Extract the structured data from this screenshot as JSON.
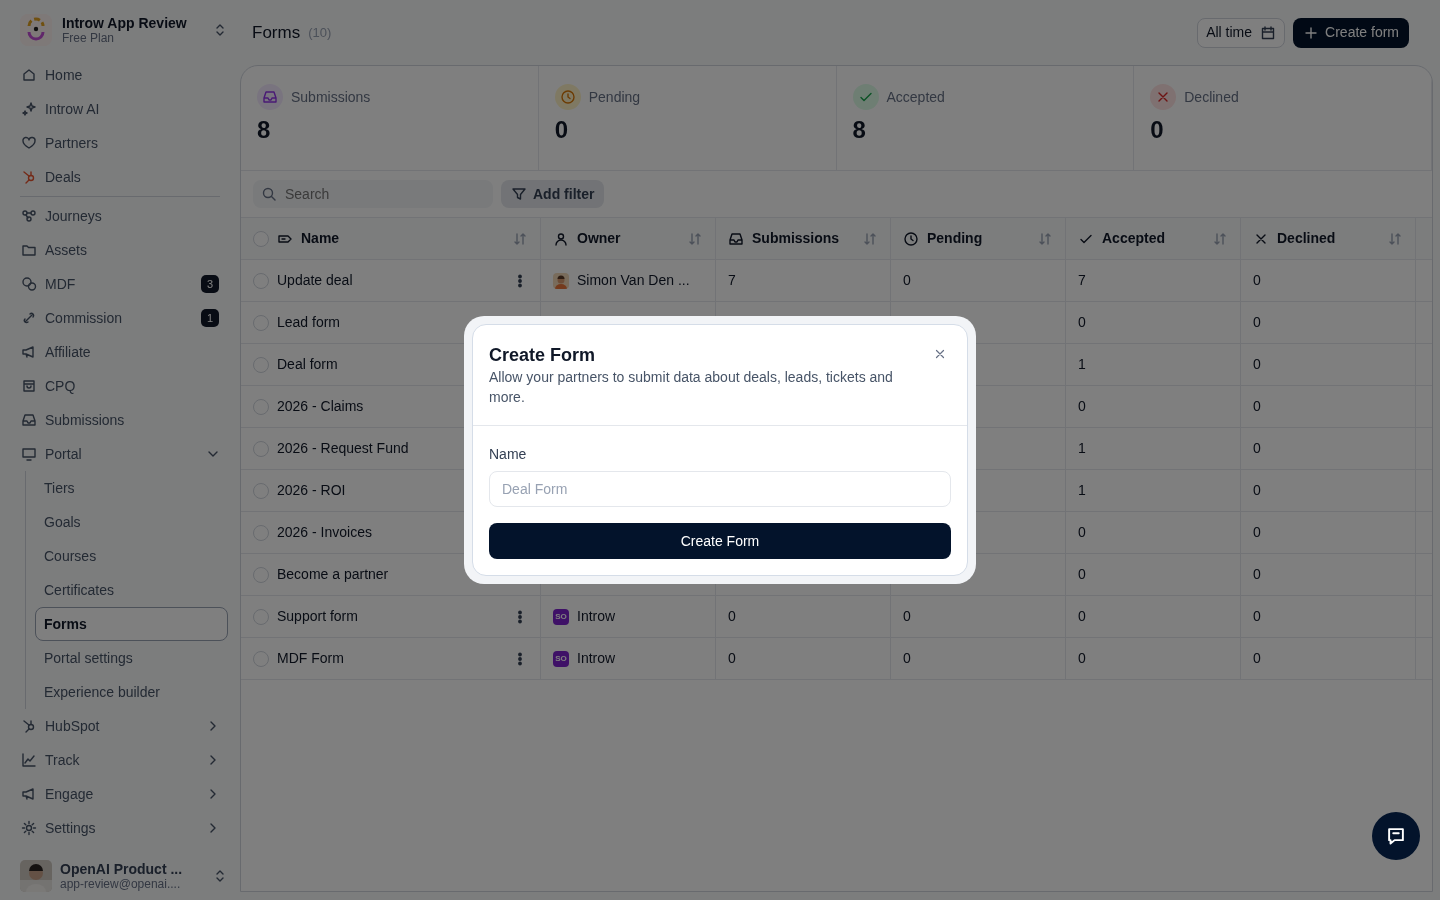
{
  "sidebar": {
    "workspace": {
      "name": "Introw App Review",
      "plan": "Free Plan"
    },
    "sections": [
      [
        {
          "label": "Home",
          "selected": false
        },
        {
          "label": "Introw AI",
          "selected": false
        },
        {
          "label": "Partners",
          "selected": false
        },
        {
          "label": "Deals",
          "selected": false
        }
      ],
      [
        {
          "label": "Journeys",
          "selected": false
        },
        {
          "label": "Assets",
          "selected": false
        },
        {
          "label": "MDF",
          "selected": false,
          "badge": "3"
        },
        {
          "label": "Commission",
          "selected": false,
          "badge": "1"
        },
        {
          "label": "Affiliate",
          "selected": false
        },
        {
          "label": "CPQ",
          "selected": false
        },
        {
          "label": "Submissions",
          "selected": false
        },
        {
          "label": "Portal",
          "selected": false,
          "expanded": true,
          "children": [
            {
              "label": "Tiers",
              "selected": false
            },
            {
              "label": "Goals",
              "selected": false
            },
            {
              "label": "Courses",
              "selected": false
            },
            {
              "label": "Certificates",
              "selected": false
            },
            {
              "label": "Forms",
              "selected": true
            },
            {
              "label": "Portal settings",
              "selected": false
            },
            {
              "label": "Experience builder",
              "selected": false
            }
          ]
        },
        {
          "label": "HubSpot",
          "selected": false,
          "expanded": false
        },
        {
          "label": "Track",
          "selected": false,
          "expanded": false
        },
        {
          "label": "Engage",
          "selected": false,
          "expanded": false
        },
        {
          "label": "Settings",
          "selected": false,
          "expanded": false
        }
      ]
    ],
    "user": {
      "name": "OpenAI Product ...",
      "email": "app-review@openai...."
    }
  },
  "header": {
    "title": "Forms",
    "count": "(10)",
    "date_button": "All time",
    "create_button": "Create form"
  },
  "stats": [
    {
      "label": "Submissions",
      "value": "8"
    },
    {
      "label": "Pending",
      "value": "0"
    },
    {
      "label": "Accepted",
      "value": "8"
    },
    {
      "label": "Declined",
      "value": "0"
    }
  ],
  "toolbar": {
    "search": {
      "placeholder": "Search"
    },
    "filter_button": "Add filter"
  },
  "table": {
    "all_checked": false,
    "columns": [
      "Name",
      "Owner",
      "Submissions",
      "Pending",
      "Accepted",
      "Declined"
    ],
    "rows": [
      {
        "checked": false,
        "name": "Update deal",
        "owner": {
          "name": "Simon Van Den ..."
        },
        "submissions": "7",
        "pending": "0",
        "accepted": "7",
        "declined": "0"
      },
      {
        "checked": false,
        "name": "Lead form",
        "accepted": "0",
        "declined": "0"
      },
      {
        "checked": false,
        "name": "Deal form",
        "accepted": "1",
        "declined": "0"
      },
      {
        "checked": false,
        "name": "2026 - Claims",
        "accepted": "0",
        "declined": "0"
      },
      {
        "checked": false,
        "name": "2026 - Request Fund",
        "accepted": "1",
        "declined": "0"
      },
      {
        "checked": false,
        "name": "2026 - ROI",
        "accepted": "1",
        "declined": "0"
      },
      {
        "checked": false,
        "name": "2026 - Invoices",
        "accepted": "0",
        "declined": "0"
      },
      {
        "checked": false,
        "name": "Become a partner",
        "accepted": "0",
        "declined": "0"
      },
      {
        "checked": false,
        "name": "Support form",
        "owner": {
          "kind": "initials",
          "initials": "SO",
          "name": "Introw"
        },
        "submissions": "0",
        "pending": "0",
        "accepted": "0",
        "declined": "0"
      },
      {
        "checked": false,
        "name": "MDF Form",
        "owner": {
          "kind": "initials",
          "initials": "SO",
          "name": "Introw"
        },
        "submissions": "0",
        "pending": "0",
        "accepted": "0",
        "declined": "0"
      }
    ]
  },
  "modal": {
    "title": "Create Form",
    "description": "Allow your partners to submit data about deals, leads, tickets and more.",
    "field": {
      "label": "Name",
      "placeholder": "Deal Form"
    },
    "submit": "Create Form"
  }
}
